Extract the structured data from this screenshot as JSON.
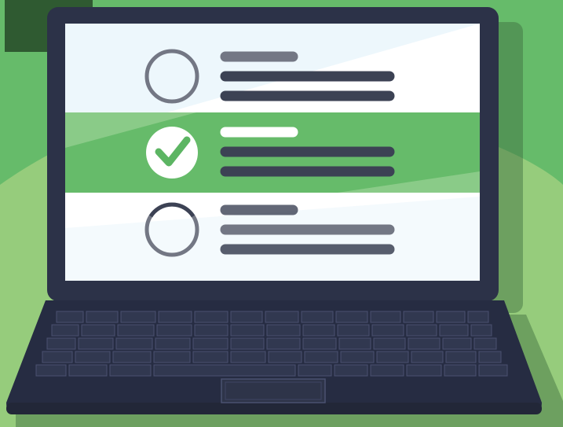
{
  "colors": {
    "background_green": "#66BB6A",
    "background_light_green": "#96CC7C",
    "dark_green_block": "#2F5A31",
    "laptop_body": "#262C42",
    "screen_bezel": "#2C3248",
    "screen_white": "#FFFFFF",
    "screen_tint": "#EDF7FC",
    "selected_row_green": "#66BB6A",
    "text_line_dark": "#3C4254",
    "text_line_gray": "#737784",
    "checkmark_green": "#5CB563"
  },
  "illustration": {
    "subject": "laptop-checklist",
    "icons": [
      "empty-circle-icon",
      "checkmark-circle-icon",
      "empty-circle-icon"
    ]
  },
  "checklist": {
    "items": [
      {
        "state": "unchecked"
      },
      {
        "state": "checked"
      },
      {
        "state": "unchecked"
      }
    ]
  }
}
